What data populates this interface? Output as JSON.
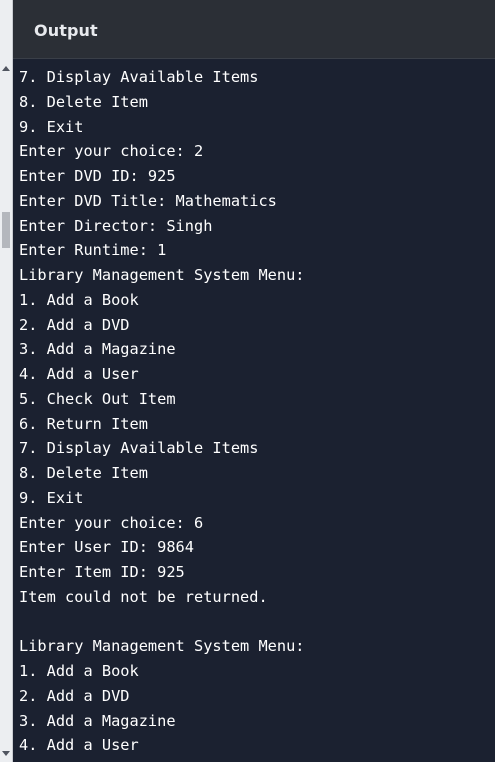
{
  "panel": {
    "title": "Output"
  },
  "output": {
    "lines": [
      "7. Display Available Items",
      "8. Delete Item",
      "9. Exit",
      "Enter your choice: 2",
      "Enter DVD ID: 925",
      "Enter DVD Title: Mathematics",
      "Enter Director: Singh",
      "Enter Runtime: 1",
      "Library Management System Menu:",
      "1. Add a Book",
      "2. Add a DVD",
      "3. Add a Magazine",
      "4. Add a User",
      "5. Check Out Item",
      "6. Return Item",
      "7. Display Available Items",
      "8. Delete Item",
      "9. Exit",
      "Enter your choice: 6",
      "Enter User ID: 9864",
      "Enter Item ID: 925",
      "Item could not be returned.",
      "",
      "Library Management System Menu:",
      "1. Add a Book",
      "2. Add a DVD",
      "3. Add a Magazine",
      "4. Add a User"
    ]
  },
  "colors": {
    "console_background": "#1b2130",
    "header_background": "#2b2f36",
    "text": "#ffffff"
  }
}
